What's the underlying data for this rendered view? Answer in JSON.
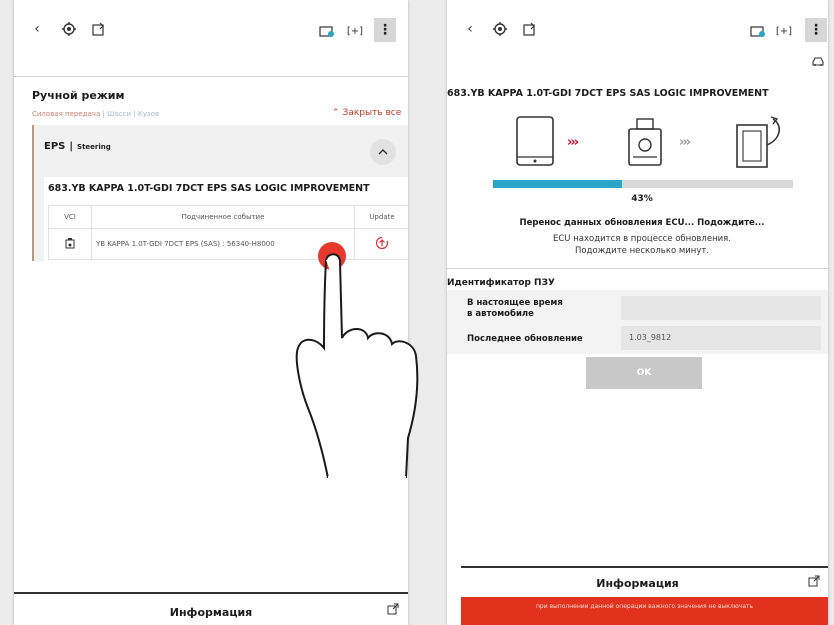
{
  "left": {
    "section_title": "Ручной режим",
    "breadcrumb": [
      "Силовая передача",
      "Шасси",
      "Кузов"
    ],
    "close_all": "Закрыть все",
    "system": {
      "name": "EPS",
      "sub": "Steering"
    },
    "event_title": "683.YB KAPPA 1.0T-GDI 7DCT EPS SAS LOGIC IMPROVEMENT",
    "table": {
      "headers": [
        "VCI",
        "Подчиненное событие",
        "Update"
      ],
      "rows": [
        {
          "event": "YB KAPPA 1.0T-GDI 7DCT EPS (SAS) : 56340-H8000"
        }
      ]
    },
    "footer": "Информация"
  },
  "right": {
    "update_title": "683.YB KAPPA 1.0T-GDI 7DCT EPS SAS LOGIC IMPROVEMENT",
    "progress": {
      "percent": 43,
      "label": "43%"
    },
    "message_main": "Перенос данных обновления ECU... Подождите...",
    "message_sub1": "ECU находится в процессе обновления.",
    "message_sub2": "Подождите несколько минут.",
    "id_title": "Идентификатор ПЗУ",
    "id_rows": [
      {
        "label_line1": "В настоящее время",
        "label_line2": "в автомобиле",
        "value": ""
      },
      {
        "label": "Последнее обновление",
        "value": "1.03_9812"
      }
    ],
    "ok": "OK",
    "footer": "Информация",
    "warning": "при выполнении данной операции важного значения не выключать"
  },
  "colors": {
    "accent_red": "#e2321e",
    "progress_blue": "#2aa7c8",
    "arrow_red": "#c8102e"
  },
  "icons": [
    "back-icon",
    "gear-icon",
    "upload-icon",
    "battery-icon",
    "expand-icon",
    "menu-icon",
    "car-icon",
    "chevron-up-icon",
    "vci-icon",
    "update-icon",
    "export-icon",
    "tablet-icon",
    "vci-device-icon",
    "ecu-icon"
  ]
}
